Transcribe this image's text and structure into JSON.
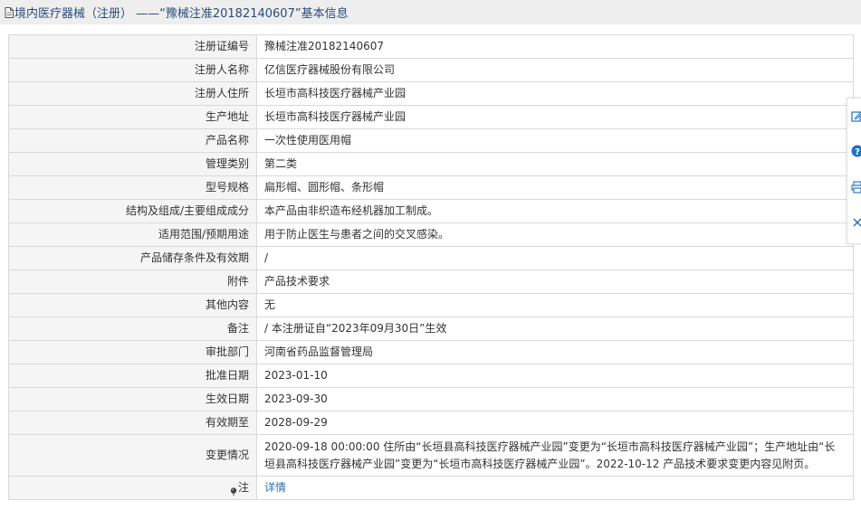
{
  "header": {
    "title": "境内医疗器械（注册） ——“豫械注准20182140607”基本信息"
  },
  "rows": [
    {
      "label": "注册证编号",
      "value": "豫械注准20182140607"
    },
    {
      "label": "注册人名称",
      "value": "亿信医疗器械股份有限公司"
    },
    {
      "label": "注册人住所",
      "value": "长垣市高科技医疗器械产业园"
    },
    {
      "label": "生产地址",
      "value": "长垣市高科技医疗器械产业园"
    },
    {
      "label": "产品名称",
      "value": "一次性使用医用帽"
    },
    {
      "label": "管理类别",
      "value": "第二类"
    },
    {
      "label": "型号规格",
      "value": "扁形帽、圆形帽、条形帽"
    },
    {
      "label": "结构及组成/主要组成成分",
      "value": "本产品由非织造布经机器加工制成。"
    },
    {
      "label": "适用范围/预期用途",
      "value": "用于防止医生与患者之间的交叉感染。"
    },
    {
      "label": "产品储存条件及有效期",
      "value": "/"
    },
    {
      "label": "附件",
      "value": "产品技术要求"
    },
    {
      "label": "其他内容",
      "value": "无"
    },
    {
      "label": "备注",
      "value": "/ 本注册证自“2023年09月30日”生效"
    },
    {
      "label": "审批部门",
      "value": "河南省药品监督管理局"
    },
    {
      "label": "批准日期",
      "value": "2023-01-10"
    },
    {
      "label": "生效日期",
      "value": "2023-09-30"
    },
    {
      "label": "有效期至",
      "value": "2028-09-29"
    },
    {
      "label": "变更情况",
      "value": "2020-09-18 00:00:00 住所由“长垣县高科技医疗器械产业园”变更为“长垣市高科技医疗器械产业园”；生产地址由“长垣县高科技医疗器械产业园”变更为“长垣市高科技医疗器械产业园”。2022-10-12 产品技术要求变更内容见附页。"
    }
  ],
  "note_row": {
    "label": "注",
    "link_text": "详情"
  },
  "icons": {
    "title": "document-icon",
    "note": "pin-icon",
    "float": [
      "edit-icon",
      "help-icon",
      "print-icon",
      "close-icon"
    ]
  },
  "colors": {
    "title_text": "#2a4a7a",
    "link": "#2f6fb3",
    "label_bg": "#f5f5f5",
    "border": "#d9d9d9",
    "accent_blue": "#1f6fc5"
  }
}
